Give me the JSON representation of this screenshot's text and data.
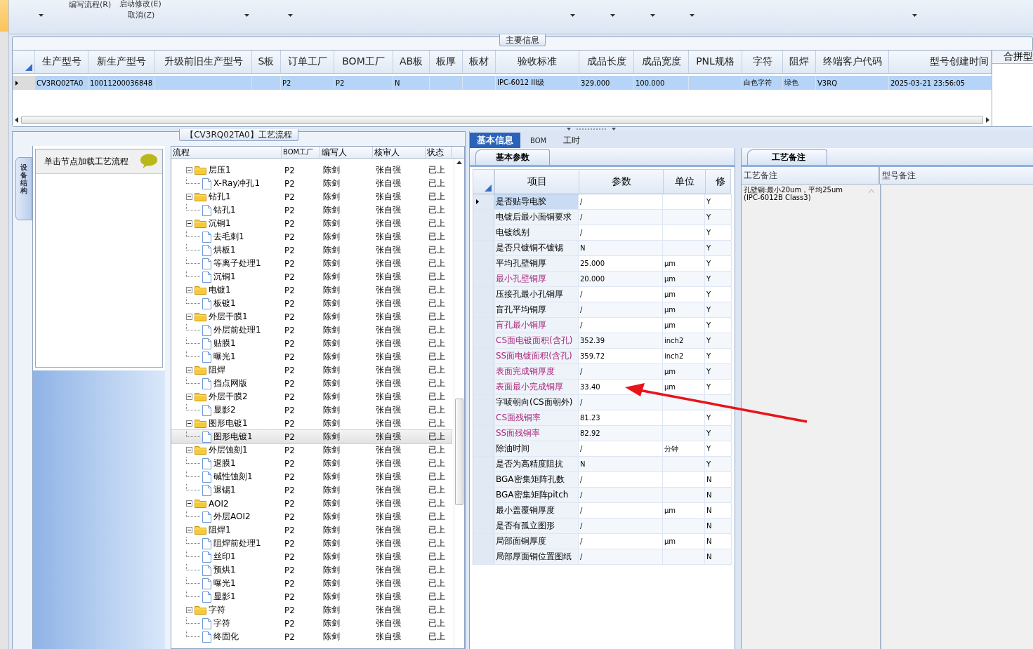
{
  "toolbar": {
    "items": [
      {
        "label": "编写流程(R)"
      },
      {
        "label": "启动修改(E)"
      },
      {
        "label": "取消(Z)"
      }
    ]
  },
  "main_info": {
    "title": "主要信息",
    "columns": [
      "生产型号",
      "新生产型号",
      "升级前旧生产型号",
      "S板",
      "订单工厂",
      "BOM工厂",
      "AB板",
      "板厚",
      "板材",
      "验收标准",
      "成品长度",
      "成品宽度",
      "PNL规格",
      "字符",
      "阻焊",
      "终端客户代码",
      "型号创建时间"
    ],
    "rows": [
      {
        "selected": true,
        "cells": [
          "CV3RQ02TA0",
          "10011200036848",
          null,
          null,
          "P2",
          "P2",
          "N",
          null,
          null,
          "IPC-6012 III级",
          "329.000",
          "100.000",
          null,
          "白色字符",
          "绿色",
          "V3RQ",
          "2025-03-21 23:56:05"
        ]
      }
    ],
    "side_column": "合拼型"
  },
  "process_flow": {
    "title": "【CV3RQ02TA0】工艺流程",
    "side_tab": "设备结构",
    "hint": "单击节点加载工艺流程",
    "columns": [
      "流程",
      "BOM工厂",
      "编写人",
      "核审人",
      "状态"
    ],
    "tree": [
      {
        "name": "层压1",
        "bom": "P2",
        "writer": "陈剑",
        "reviewer": "张自强",
        "status": "已上",
        "expanded": true,
        "selected": false,
        "children": [
          {
            "name": "X-Ray冲孔1",
            "bom": "P2",
            "writer": "陈剑",
            "reviewer": "张自强",
            "status": "已上",
            "selected": false
          }
        ]
      },
      {
        "name": "钻孔1",
        "bom": "P2",
        "writer": "陈剑",
        "reviewer": "张自强",
        "status": "已上",
        "expanded": true,
        "selected": false,
        "children": [
          {
            "name": "钻孔1",
            "bom": "P2",
            "writer": "陈剑",
            "reviewer": "张自强",
            "status": "已上",
            "selected": false
          }
        ]
      },
      {
        "name": "沉铜1",
        "bom": "P2",
        "writer": "陈剑",
        "reviewer": "张自强",
        "status": "已上",
        "expanded": true,
        "selected": false,
        "children": [
          {
            "name": "去毛刺1",
            "bom": "P2",
            "writer": "陈剑",
            "reviewer": "张自强",
            "status": "已上",
            "selected": false
          },
          {
            "name": "烘板1",
            "bom": "P2",
            "writer": "陈剑",
            "reviewer": "张自强",
            "status": "已上",
            "selected": false
          },
          {
            "name": "等离子处理1",
            "bom": "P2",
            "writer": "陈剑",
            "reviewer": "张自强",
            "status": "已上",
            "selected": false
          },
          {
            "name": "沉铜1",
            "bom": "P2",
            "writer": "陈剑",
            "reviewer": "张自强",
            "status": "已上",
            "selected": false
          }
        ]
      },
      {
        "name": "电镀1",
        "bom": "P2",
        "writer": "陈剑",
        "reviewer": "张自强",
        "status": "已上",
        "expanded": true,
        "selected": false,
        "children": [
          {
            "name": "板镀1",
            "bom": "P2",
            "writer": "陈剑",
            "reviewer": "张自强",
            "status": "已上",
            "selected": false
          }
        ]
      },
      {
        "name": "外层干膜1",
        "bom": "P2",
        "writer": "陈剑",
        "reviewer": "张自强",
        "status": "已上",
        "expanded": true,
        "selected": false,
        "children": [
          {
            "name": "外层前处理1",
            "bom": "P2",
            "writer": "陈剑",
            "reviewer": "张自强",
            "status": "已上",
            "selected": false
          },
          {
            "name": "贴膜1",
            "bom": "P2",
            "writer": "陈剑",
            "reviewer": "张自强",
            "status": "已上",
            "selected": false
          },
          {
            "name": "曝光1",
            "bom": "P2",
            "writer": "陈剑",
            "reviewer": "张自强",
            "status": "已上",
            "selected": false
          }
        ]
      },
      {
        "name": "阻焊",
        "bom": "P2",
        "writer": "陈剑",
        "reviewer": "张自强",
        "status": "已上",
        "expanded": true,
        "selected": false,
        "children": [
          {
            "name": "挡点网版",
            "bom": "P2",
            "writer": "陈剑",
            "reviewer": "张自强",
            "status": "已上",
            "selected": false
          }
        ]
      },
      {
        "name": "外层干膜2",
        "bom": "P2",
        "writer": "陈剑",
        "reviewer": "张自强",
        "status": "已上",
        "expanded": true,
        "selected": false,
        "children": [
          {
            "name": "显影2",
            "bom": "P2",
            "writer": "陈剑",
            "reviewer": "张自强",
            "status": "已上",
            "selected": false
          }
        ]
      },
      {
        "name": "图形电镀1",
        "bom": "P2",
        "writer": "陈剑",
        "reviewer": "张自强",
        "status": "已上",
        "expanded": true,
        "selected": false,
        "children": [
          {
            "name": "图形电镀1",
            "bom": "P2",
            "writer": "陈剑",
            "reviewer": "张自强",
            "status": "已上",
            "selected": true
          }
        ]
      },
      {
        "name": "外层蚀刻1",
        "bom": "P2",
        "writer": "陈剑",
        "reviewer": "张自强",
        "status": "已上",
        "expanded": true,
        "selected": false,
        "children": [
          {
            "name": "退膜1",
            "bom": "P2",
            "writer": "陈剑",
            "reviewer": "张自强",
            "status": "已上",
            "selected": false
          },
          {
            "name": "碱性蚀刻1",
            "bom": "P2",
            "writer": "陈剑",
            "reviewer": "张自强",
            "status": "已上",
            "selected": false
          },
          {
            "name": "退锡1",
            "bom": "P2",
            "writer": "陈剑",
            "reviewer": "张自强",
            "status": "已上",
            "selected": false
          }
        ]
      },
      {
        "name": "AOI2",
        "bom": "P2",
        "writer": "陈剑",
        "reviewer": "张自强",
        "status": "已上",
        "expanded": true,
        "selected": false,
        "children": [
          {
            "name": "外层AOI2",
            "bom": "P2",
            "writer": "陈剑",
            "reviewer": "张自强",
            "status": "已上",
            "selected": false
          }
        ]
      },
      {
        "name": "阻焊1",
        "bom": "P2",
        "writer": "陈剑",
        "reviewer": "张自强",
        "status": "已上",
        "expanded": true,
        "selected": false,
        "children": [
          {
            "name": "阻焊前处理1",
            "bom": "P2",
            "writer": "陈剑",
            "reviewer": "张自强",
            "status": "已上",
            "selected": false
          },
          {
            "name": "丝印1",
            "bom": "P2",
            "writer": "陈剑",
            "reviewer": "张自强",
            "status": "已上",
            "selected": false
          },
          {
            "name": "预烘1",
            "bom": "P2",
            "writer": "陈剑",
            "reviewer": "张自强",
            "status": "已上",
            "selected": false
          },
          {
            "name": "曝光1",
            "bom": "P2",
            "writer": "陈剑",
            "reviewer": "张自强",
            "status": "已上",
            "selected": false
          },
          {
            "name": "显影1",
            "bom": "P2",
            "writer": "陈剑",
            "reviewer": "张自强",
            "status": "已上",
            "selected": false
          }
        ]
      },
      {
        "name": "字符",
        "bom": "P2",
        "writer": "陈剑",
        "reviewer": "张自强",
        "status": "已上",
        "expanded": true,
        "selected": false,
        "children": [
          {
            "name": "字符",
            "bom": "P2",
            "writer": "陈剑",
            "reviewer": "张自强",
            "status": "已上",
            "selected": false
          },
          {
            "name": "终固化",
            "bom": "P2",
            "writer": "陈剑",
            "reviewer": "张自强",
            "status": "已上",
            "selected": false
          }
        ]
      }
    ]
  },
  "details": {
    "tabs": [
      {
        "label": "基本信息",
        "selected": true
      },
      {
        "label": "BOM",
        "selected": false
      },
      {
        "label": "工时",
        "selected": false
      }
    ],
    "subtab": "基本参数",
    "columns": [
      "项目",
      "参数",
      "单位",
      "修"
    ],
    "rows": [
      {
        "item": "是否贴导电胶",
        "value": "/",
        "modified": "Y",
        "highlighted": false,
        "selected": true
      },
      {
        "item": "电镀后最小面铜要求",
        "value": "/",
        "modified": "Y",
        "highlighted": false,
        "selected": false
      },
      {
        "item": "电镀线别",
        "value": "/",
        "modified": "Y",
        "highlighted": false,
        "selected": false
      },
      {
        "item": "是否只镀铜不镀锡",
        "value": "N",
        "modified": "Y",
        "highlighted": false,
        "selected": false
      },
      {
        "item": "平均孔壁铜厚",
        "value": "25.000",
        "unit": "μm",
        "modified": "Y",
        "highlighted": false,
        "selected": false
      },
      {
        "item": "最小孔壁铜厚",
        "value": "20.000",
        "unit": "μm",
        "modified": "Y",
        "highlighted": true,
        "selected": false
      },
      {
        "item": "压接孔最小孔铜厚",
        "value": "/",
        "unit": "μm",
        "modified": "Y",
        "highlighted": false,
        "selected": false
      },
      {
        "item": "盲孔平均铜厚",
        "value": "/",
        "unit": "μm",
        "modified": "Y",
        "highlighted": false,
        "selected": false
      },
      {
        "item": "盲孔最小铜厚",
        "value": "/",
        "unit": "μm",
        "modified": "Y",
        "highlighted": true,
        "selected": false
      },
      {
        "item": "CS面电镀面积(含孔)",
        "value": "352.39",
        "unit": "inch2",
        "modified": "Y",
        "highlighted": true,
        "selected": false
      },
      {
        "item": "SS面电镀面积(含孔)",
        "value": "359.72",
        "unit": "inch2",
        "modified": "Y",
        "highlighted": true,
        "selected": false
      },
      {
        "item": "表面完成铜厚度",
        "value": "/",
        "unit": "μm",
        "modified": "Y",
        "highlighted": true,
        "selected": false
      },
      {
        "item": "表面最小完成铜厚",
        "value": "33.40",
        "unit": "μm",
        "modified": "Y",
        "highlighted": true,
        "selected": false
      },
      {
        "item": "字唛朝向(CS面朝外)",
        "value": "/",
        "highlighted": false,
        "selected": false
      },
      {
        "item": "CS面残铜率",
        "value": "81.23",
        "modified": "Y",
        "highlighted": true,
        "selected": false
      },
      {
        "item": "SS面残铜率",
        "value": "82.92",
        "modified": "Y",
        "highlighted": true,
        "selected": false
      },
      {
        "item": "除油时间",
        "value": "/",
        "unit": "分钟",
        "modified": "Y",
        "highlighted": false,
        "selected": false
      },
      {
        "item": "是否为高精度阻抗",
        "value": "N",
        "modified": "Y",
        "highlighted": false,
        "selected": false
      },
      {
        "item": "BGA密集矩阵孔数",
        "value": "/",
        "modified": "N",
        "highlighted": false,
        "selected": false
      },
      {
        "item": "BGA密集矩阵pitch",
        "value": "/",
        "modified": "N",
        "highlighted": false,
        "selected": false
      },
      {
        "item": "最小盖覆铜厚度",
        "value": "/",
        "unit": "μm",
        "modified": "N",
        "highlighted": false,
        "selected": false
      },
      {
        "item": "是否有孤立图形",
        "value": "/",
        "modified": "N",
        "highlighted": false,
        "selected": false
      },
      {
        "item": "局部面铜厚度",
        "value": "/",
        "unit": "μm",
        "modified": "N",
        "highlighted": false,
        "selected": false
      },
      {
        "item": "局部厚面铜位置图纸",
        "value": "/",
        "modified": "N",
        "highlighted": false,
        "selected": false
      }
    ]
  },
  "notes": {
    "tab": "工艺备注",
    "columns": [
      "工艺备注",
      "型号备注"
    ],
    "process_note": [
      "孔壁铜:最小20um，平均25um",
      "(IPC-6012B Class3)"
    ]
  }
}
